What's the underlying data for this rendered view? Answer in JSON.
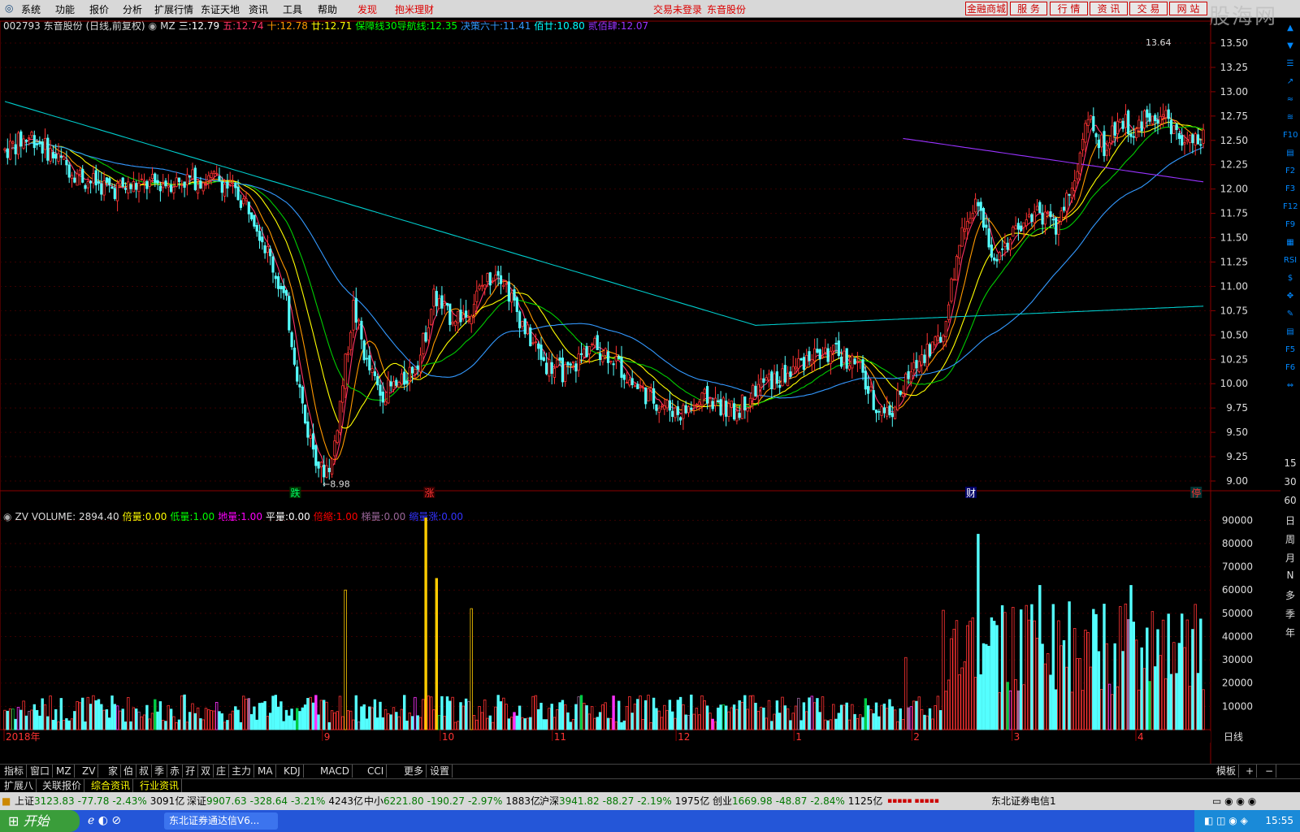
{
  "menu": {
    "items": [
      "系统",
      "功能",
      "报价",
      "分析",
      "扩展行情",
      "东证天地",
      "资讯",
      "工具",
      "帮助"
    ],
    "highlight": [
      "发现",
      "抱米理财"
    ],
    "center": [
      "交易未登录",
      "东音股份"
    ],
    "right": [
      "金融商城",
      "服 务",
      "行 情",
      "资 讯",
      "交 易",
      "网 站"
    ],
    "watermark": "股海网"
  },
  "header": {
    "code_name": "002793 东音股份 (日线,前复权)",
    "mz_label": "MZ",
    "ma": [
      {
        "label": "三:",
        "value": "12.79",
        "color": "#ffffff"
      },
      {
        "label": "五:",
        "value": "12.74",
        "color": "#ff3366"
      },
      {
        "label": "十:",
        "value": "12.78",
        "color": "#ff9900"
      },
      {
        "label": "廿:",
        "value": "12.71",
        "color": "#ffff00"
      },
      {
        "label": "保障线30导航线:",
        "value": "12.35",
        "color": "#00ff00"
      },
      {
        "label": "决策六十:",
        "value": "11.41",
        "color": "#3399ff"
      },
      {
        "label": "佰廿:",
        "value": "10.80",
        "color": "#00ffff"
      },
      {
        "label": "贰佰肆:",
        "value": "12.07",
        "color": "#9933ff"
      }
    ]
  },
  "volume_header": {
    "zv": "ZV",
    "volume": "VOLUME: 2894.40",
    "items": [
      {
        "label": "倍量:",
        "value": "0.00",
        "color": "#ffff00"
      },
      {
        "label": "低量:",
        "value": "1.00",
        "color": "#00ff00"
      },
      {
        "label": "地量:",
        "value": "1.00",
        "color": "#ff00ff"
      },
      {
        "label": "平量:",
        "value": "0.00",
        "color": "#ffffff"
      },
      {
        "label": "倍缩:",
        "value": "1.00",
        "color": "#ff0000"
      },
      {
        "label": "梯量:",
        "value": "0.00",
        "color": "#996699"
      },
      {
        "label": "缩量涨:",
        "value": "0.00",
        "color": "#3333ff"
      }
    ]
  },
  "price_axis": [
    "13.50",
    "13.25",
    "13.00",
    "12.75",
    "12.50",
    "12.25",
    "12.00",
    "11.75",
    "11.50",
    "11.25",
    "11.00",
    "10.75",
    "10.50",
    "10.25",
    "10.00",
    "9.75",
    "9.50",
    "9.25",
    "9.00"
  ],
  "volume_axis": [
    "90000",
    "80000",
    "70000",
    "60000",
    "50000",
    "40000",
    "30000",
    "20000",
    "10000"
  ],
  "time_axis": [
    {
      "label": "2018年",
      "month": 6.0
    },
    {
      "label": "9",
      "month": 8.7
    },
    {
      "label": "10",
      "month": 9.7
    },
    {
      "label": "11",
      "month": 10.65
    },
    {
      "label": "12",
      "month": 11.7
    },
    {
      "label": "1",
      "month": 12.7
    },
    {
      "label": "2",
      "month": 13.7
    },
    {
      "label": "3",
      "month": 14.55
    },
    {
      "label": "4",
      "month": 15.6
    }
  ],
  "chart_labels": {
    "low": "←8.98",
    "high": "13.64",
    "events": [
      {
        "label": "跌",
        "color": "#00ff66",
        "bg": "#003300",
        "bar": 108
      },
      {
        "label": "涨",
        "color": "#ff3333",
        "bg": "#330000",
        "bar": 158
      },
      {
        "label": "财",
        "color": "#ffffff",
        "bg": "#000066",
        "bar": 360
      },
      {
        "label": "停",
        "color": "#ff3333",
        "bg": "#003333",
        "bar": 444
      }
    ]
  },
  "chart_data": {
    "type": "candlestick",
    "timeframe": "日线",
    "ylim": [
      8.9,
      13.7
    ],
    "control_points": [
      [
        0,
        12.4
      ],
      [
        10,
        12.55
      ],
      [
        20,
        12.3
      ],
      [
        30,
        12.1
      ],
      [
        40,
        12.0
      ],
      [
        55,
        12.05
      ],
      [
        70,
        12.1
      ],
      [
        80,
        12.1
      ],
      [
        92,
        11.8
      ],
      [
        100,
        11.2
      ],
      [
        105,
        10.8
      ],
      [
        112,
        9.6
      ],
      [
        118,
        9.1
      ],
      [
        122,
        9.2
      ],
      [
        126,
        10.0
      ],
      [
        130,
        10.8
      ],
      [
        135,
        10.2
      ],
      [
        140,
        9.9
      ],
      [
        148,
        10.0
      ],
      [
        155,
        10.3
      ],
      [
        160,
        10.9
      ],
      [
        165,
        10.7
      ],
      [
        172,
        10.7
      ],
      [
        178,
        11.0
      ],
      [
        184,
        11.2
      ],
      [
        190,
        10.8
      ],
      [
        195,
        10.5
      ],
      [
        202,
        10.2
      ],
      [
        210,
        10.1
      ],
      [
        218,
        10.4
      ],
      [
        226,
        10.3
      ],
      [
        234,
        10.0
      ],
      [
        244,
        9.8
      ],
      [
        252,
        9.7
      ],
      [
        262,
        9.85
      ],
      [
        272,
        9.7
      ],
      [
        282,
        10.0
      ],
      [
        290,
        10.05
      ],
      [
        300,
        10.3
      ],
      [
        310,
        10.3
      ],
      [
        318,
        10.2
      ],
      [
        324,
        9.8
      ],
      [
        330,
        9.7
      ],
      [
        336,
        10.0
      ],
      [
        342,
        10.3
      ],
      [
        350,
        10.5
      ],
      [
        356,
        11.5
      ],
      [
        362,
        11.9
      ],
      [
        368,
        11.3
      ],
      [
        376,
        11.5
      ],
      [
        384,
        11.8
      ],
      [
        392,
        11.6
      ],
      [
        398,
        12.0
      ],
      [
        404,
        12.7
      ],
      [
        410,
        12.4
      ],
      [
        416,
        12.7
      ],
      [
        422,
        12.6
      ],
      [
        428,
        12.8
      ],
      [
        434,
        12.7
      ],
      [
        440,
        12.45
      ],
      [
        446,
        12.5
      ]
    ],
    "ma_periods": [
      5,
      10,
      20,
      30,
      60,
      120,
      244
    ],
    "volume_ylim": [
      0,
      95000
    ]
  },
  "right_tools": [
    "▲",
    "▼",
    "☰",
    "↗",
    "≈",
    "≋",
    "F10",
    "▤",
    "F2",
    "F3",
    "F12",
    "F9",
    "▦",
    "RSI",
    "$",
    "✥",
    "✎",
    "▤",
    "F5",
    "F6",
    "⇔"
  ],
  "periods": [
    "15",
    "30",
    "60",
    "日",
    "周",
    "月",
    "N",
    "多",
    "季",
    "年"
  ],
  "bottom_tabs_1": [
    "指标",
    "窗口",
    "MZ",
    "ZV",
    "家",
    "伯",
    "叔",
    "季",
    "赤",
    "孖",
    "双",
    "庄",
    "主力",
    "MA",
    "KDJ",
    "MACD",
    "CCI",
    "更多",
    "设置"
  ],
  "bottom_tabs_2": [
    "扩展八",
    "关联报价",
    "综合资讯",
    "行业资讯"
  ],
  "bottom_right": [
    "日线",
    "模板",
    "+",
    "−"
  ],
  "status": [
    {
      "name": "上证",
      "value": "3123.83",
      "change": "-77.78",
      "pct": "-2.43%",
      "amount": "3091亿"
    },
    {
      "name": "深证",
      "value": "9907.63",
      "change": "-328.64",
      "pct": "-3.21%",
      "amount": "4243亿"
    },
    {
      "name": "中小",
      "value": "6221.80",
      "change": "-190.27",
      "pct": "-2.97%",
      "amount": "1883亿"
    },
    {
      "name": "沪深",
      "value": "3941.82",
      "change": "-88.27",
      "pct": "-2.19%",
      "amount": "1975亿"
    },
    {
      "name": "创业",
      "value": "1669.98",
      "change": "-48.87",
      "pct": "-2.84%",
      "amount": "1125亿"
    }
  ],
  "status_right": "东北证券电信1",
  "taskbar": {
    "start": "开始",
    "app": "东北证券通达信V6...",
    "time": "15:55"
  }
}
